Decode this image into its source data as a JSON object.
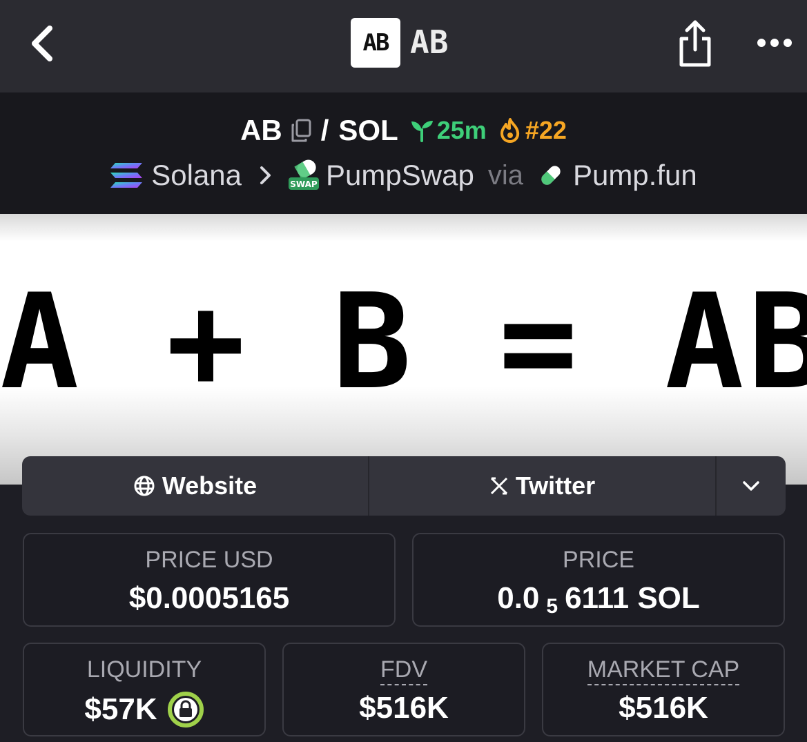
{
  "appbar": {
    "logo_text": "AB",
    "title": "AB",
    "icons": {
      "back": "chevron-left-icon",
      "share": "share-icon",
      "more": "more-horizontal-icon"
    }
  },
  "pair": {
    "base": "AB",
    "separator": "/",
    "quote": "SOL",
    "age": "25m",
    "rank": "#22",
    "age_color": "#3ecf79",
    "rank_color": "#f6a623"
  },
  "chain": {
    "chain_name": "Solana",
    "dex_name": "PumpSwap",
    "dex_badge": "SWAP",
    "via": "via",
    "launchpad": "Pump.fun"
  },
  "banner": {
    "text": "A + B = AB"
  },
  "links": {
    "website": "Website",
    "twitter": "Twitter"
  },
  "stats": {
    "price_usd_label": "PRICE USD",
    "price_usd_value": "$0.0005165",
    "price_label": "PRICE",
    "price_prefix": "0.0",
    "price_zeros": "5",
    "price_suffix": "6111 SOL",
    "liquidity_label": "LIQUIDITY",
    "liquidity_value": "$57K",
    "fdv_label": "FDV",
    "fdv_value": "$516K",
    "mcap_label": "MARKET CAP",
    "mcap_value": "$516K"
  }
}
